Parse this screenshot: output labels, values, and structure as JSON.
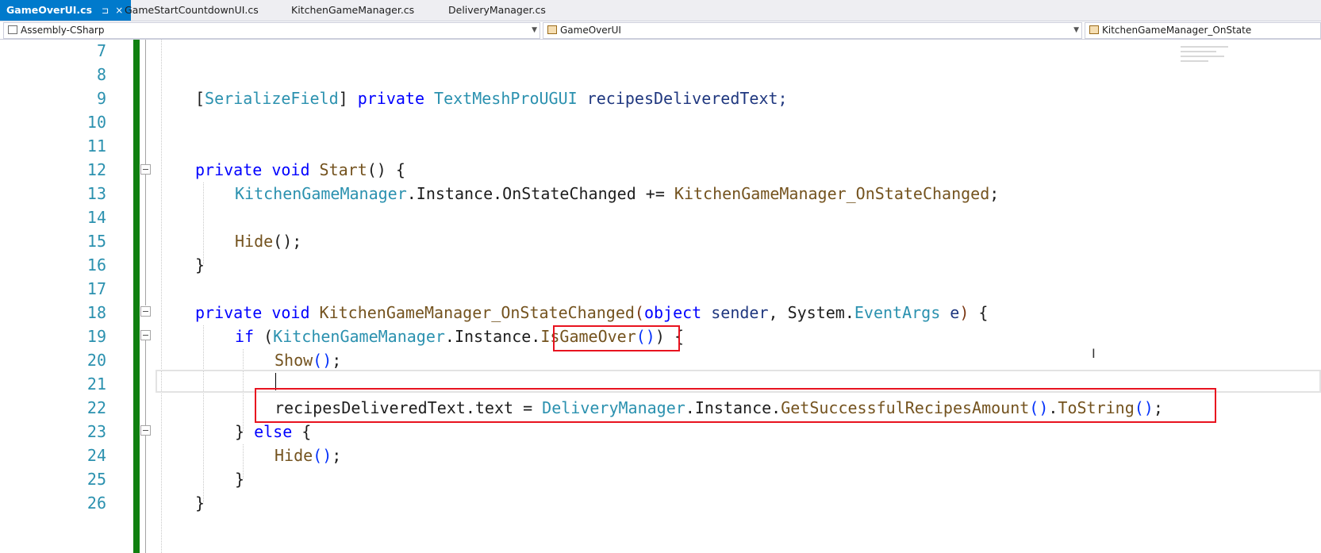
{
  "tabs": [
    {
      "label": "GameOverUI.cs",
      "pin": "⊐",
      "close": "×",
      "active": true
    },
    {
      "label": "GameStartCountdownUI.cs",
      "active": false
    },
    {
      "label": "KitchenGameManager.cs",
      "active": false
    },
    {
      "label": "DeliveryManager.cs",
      "active": false
    }
  ],
  "nav": {
    "project": "Assembly-CSharp",
    "type": "GameOverUI",
    "member": "KitchenGameManager_OnState"
  },
  "editor": {
    "line_numbers": [
      "7",
      "8",
      "9",
      "10",
      "11",
      "12",
      "13",
      "14",
      "15",
      "16",
      "17",
      "18",
      "19",
      "20",
      "21",
      "22",
      "23",
      "24",
      "25",
      "26"
    ],
    "code": {
      "l9": {
        "b1": "[",
        "attr": "SerializeField",
        "b2": "]",
        "kw": " private ",
        "ty": "TextMeshProUGUI",
        "rest": " recipesDeliveredText;"
      },
      "l12": {
        "kw1": "private ",
        "kw2": "void ",
        "fn": "Start",
        "rest": "() {"
      },
      "l13": {
        "ty": "KitchenGameManager",
        "mid": ".Instance.OnStateChanged += ",
        "fn": "KitchenGameManager_OnStateChanged",
        "end": ";"
      },
      "l15": {
        "fn": "Hide",
        "rest": "();"
      },
      "l16": {
        "text": "}"
      },
      "l18": {
        "kw1": "private ",
        "kw2": "void ",
        "fn": "KitchenGameManager_OnStateChanged",
        "p1": "(",
        "kw3": "object ",
        "v1": "sender",
        "mid": ", System.",
        "ty": "EventArgs ",
        "v2": "e",
        "p2": ")",
        "end": " {"
      },
      "l19": {
        "kw": "if ",
        "p1": "(",
        "ty": "KitchenGameManager",
        "mid": ".Instance.",
        "fn": "IsGameOver",
        "p2": "()",
        "p3": ")",
        "end": " {"
      },
      "l20": {
        "fn": "Show",
        "p": "()",
        "end": ";"
      },
      "l22": {
        "pre": "recipesDeliveredText.text = ",
        "ty": "DeliveryManager",
        "mid": ".Instance.",
        "fn1": "GetSuccessfulRecipesAmount",
        "p1": "()",
        "dot": ".",
        "fn2": "ToString",
        "p2": "()",
        "end": ";"
      },
      "l23": {
        "b": "} ",
        "kw": "else",
        "end": " {"
      },
      "l24": {
        "fn": "Hide",
        "p": "()",
        "end": ";"
      },
      "l25": {
        "text": "}"
      },
      "l26": {
        "text": "}"
      }
    }
  },
  "colors": {
    "active_tab": "#007acc",
    "change_bar": "#108010",
    "highlight_box": "#e8131f",
    "keyword": "#0000ff",
    "type": "#2b91af",
    "method": "#74531f"
  }
}
